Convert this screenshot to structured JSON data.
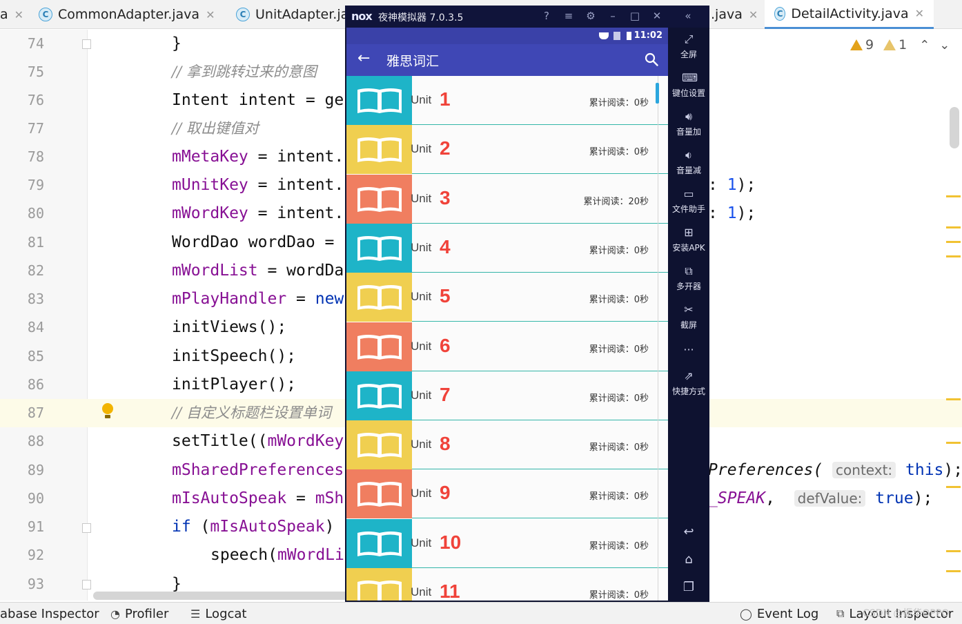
{
  "tabs": [
    {
      "label": "a",
      "icon": "",
      "active": false
    },
    {
      "label": "CommonAdapter.java",
      "icon": "C",
      "active": false
    },
    {
      "label": "UnitAdapter.ja",
      "icon": "C",
      "active": false
    },
    {
      "label": ".java",
      "icon": "",
      "active": false
    },
    {
      "label": "DetailActivity.java",
      "icon": "C",
      "active": true
    }
  ],
  "editor": {
    "lines": [
      {
        "num": "74",
        "code": "}"
      },
      {
        "num": "75",
        "comment": "// 拿到跳转过来的意图"
      },
      {
        "num": "76",
        "code": "Intent intent = ge"
      },
      {
        "num": "77",
        "comment": "// 取出键值对"
      },
      {
        "num": "78",
        "field": "mMetaKey",
        "rest": " = intent."
      },
      {
        "num": "79",
        "field": "mUnitKey",
        "rest": " = intent."
      },
      {
        "num": "80",
        "field": "mWordKey",
        "rest": " = intent."
      },
      {
        "num": "81",
        "code": "WordDao wordDao = "
      },
      {
        "num": "82",
        "field": "mWordList",
        "rest": " = wordDa"
      },
      {
        "num": "83",
        "field": "mPlayHandler",
        "rest": " = ",
        "kw": "new"
      },
      {
        "num": "84",
        "code": "initViews();"
      },
      {
        "num": "85",
        "code": "initSpeech();"
      },
      {
        "num": "86",
        "code": "initPlayer();"
      },
      {
        "num": "87",
        "comment": "// 自定义标题栏设置单词"
      },
      {
        "num": "88",
        "code": "setTitle((",
        "field": "mWordKey"
      },
      {
        "num": "89",
        "field": "mSharedPreferences"
      },
      {
        "num": "90",
        "field": "mIsAutoSpeak",
        "rest": " = ",
        "field2": "mSh"
      },
      {
        "num": "91",
        "kw": "if",
        "code": " (",
        "field": "mIsAutoSpeak",
        "rest": ")"
      },
      {
        "num": "92",
        "code": "speech(",
        "field": "mWordLi"
      },
      {
        "num": "93",
        "code": "}"
      }
    ],
    "right_fragments": {
      "line79": {
        "colon": ":",
        "num": "1",
        "end": ");"
      },
      "line80": {
        "colon": ":",
        "num": "1",
        "end": ");"
      },
      "line89": {
        "prefix": "Preferences(",
        "hint": "context:",
        "kw": "this",
        "end": ");"
      },
      "line90": {
        "const": "_SPEAK",
        "comma": ",",
        "hint": "defValue:",
        "kw": "true",
        "end": ");"
      }
    },
    "warnings": {
      "count_warn": "9",
      "count_weak": "1"
    }
  },
  "bottom_tools": [
    {
      "label": "abase Inspector",
      "icon": ""
    },
    {
      "label": "Profiler",
      "icon": "gauge-icon"
    },
    {
      "label": "Logcat",
      "icon": "list-icon"
    },
    {
      "label": "Event Log",
      "icon": "event-log-icon"
    },
    {
      "label": "Layout Inspector",
      "icon": "layout-inspector-icon"
    }
  ],
  "watermark": "CSDN @振华OPPO",
  "emulator": {
    "logo": "nox",
    "title": "夜神模拟器 7.0.3.5",
    "status_time": "11:02",
    "app_title": "雅思词汇",
    "unit_prefix": "Unit",
    "units": [
      {
        "num": "1",
        "reading": "累计阅读：0秒",
        "color": "#1eb4c8"
      },
      {
        "num": "2",
        "reading": "累计阅读：0秒",
        "color": "#f0cf50"
      },
      {
        "num": "3",
        "reading": "累计阅读：20秒",
        "color": "#f07e60"
      },
      {
        "num": "4",
        "reading": "累计阅读：0秒",
        "color": "#1eb4c8"
      },
      {
        "num": "5",
        "reading": "累计阅读：0秒",
        "color": "#f0cf50"
      },
      {
        "num": "6",
        "reading": "累计阅读：0秒",
        "color": "#f07e60"
      },
      {
        "num": "7",
        "reading": "累计阅读：0秒",
        "color": "#1eb4c8"
      },
      {
        "num": "8",
        "reading": "累计阅读：0秒",
        "color": "#f0cf50"
      },
      {
        "num": "9",
        "reading": "累计阅读：0秒",
        "color": "#f07e60"
      },
      {
        "num": "10",
        "reading": "累计阅读：0秒",
        "color": "#1eb4c8"
      },
      {
        "num": "11",
        "reading": "累计阅读：0秒",
        "color": "#f0cf50"
      }
    ],
    "side_panel": [
      {
        "label": "全屏",
        "icon": "fullscreen-icon"
      },
      {
        "label": "键位设置",
        "icon": "keyboard-icon"
      },
      {
        "label": "音量加",
        "icon": "volume-up-icon"
      },
      {
        "label": "音量减",
        "icon": "volume-down-icon"
      },
      {
        "label": "文件助手",
        "icon": "file-icon"
      },
      {
        "label": "安装APK",
        "icon": "apk-icon"
      },
      {
        "label": "多开器",
        "icon": "multi-instance-icon"
      },
      {
        "label": "截屏",
        "icon": "scissors-icon"
      },
      {
        "label": "",
        "icon": "more-icon"
      },
      {
        "label": "快捷方式",
        "icon": "shortcut-icon"
      }
    ]
  },
  "colors": {
    "appbar": "#3f47b5",
    "accent_red": "#f0433a",
    "divider": "#33b5a8",
    "emulator_bg": "#0e1230"
  }
}
